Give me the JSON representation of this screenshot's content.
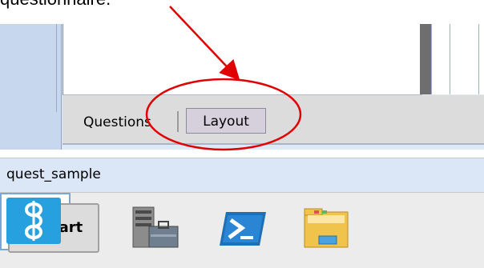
{
  "caption": "questionnaire.",
  "tabs": [
    {
      "label": "Questions"
    },
    {
      "label": "Layout"
    }
  ],
  "status": {
    "text": "quest_sample"
  },
  "taskbar": {
    "start_label": "Start",
    "items": [
      {
        "icon": "server-manager-icon"
      },
      {
        "icon": "powershell-icon"
      },
      {
        "icon": "file-explorer-icon"
      },
      {
        "icon": "application-icon"
      }
    ]
  },
  "colors": {
    "annotation": "#e00000",
    "app_icon": "#27a0e0",
    "status_bar": "#dbe6f6"
  }
}
